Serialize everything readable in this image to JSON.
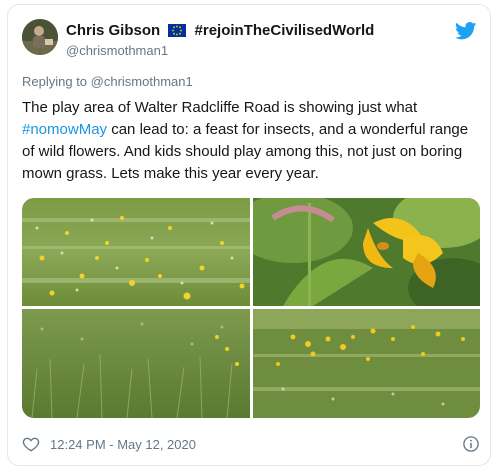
{
  "author": {
    "name": "Chris Gibson",
    "flag_icon": "eu-flag-icon",
    "hashtag_name": "#rejoinTheCivilisedWorld",
    "handle": "@chrismothman1"
  },
  "reply": {
    "prefix": "Replying to ",
    "target": "@chrismothman1"
  },
  "tweet": {
    "part1": "The play area of Walter Radcliffe Road is showing just what ",
    "hashtag": "#nomowMay",
    "part2": " can lead to: a feast for insects, and a wonderful range of wild flowers. And kids should play among this, not just on boring mown grass. Lets make this year every year."
  },
  "footer": {
    "timestamp": "12:24 PM - May 12, 2020",
    "like_icon": "heart-icon",
    "info_icon": "info-icon"
  },
  "colors": {
    "link": "#1b95e0",
    "secondary": "#657786",
    "twitter_blue": "#1da1f2"
  }
}
